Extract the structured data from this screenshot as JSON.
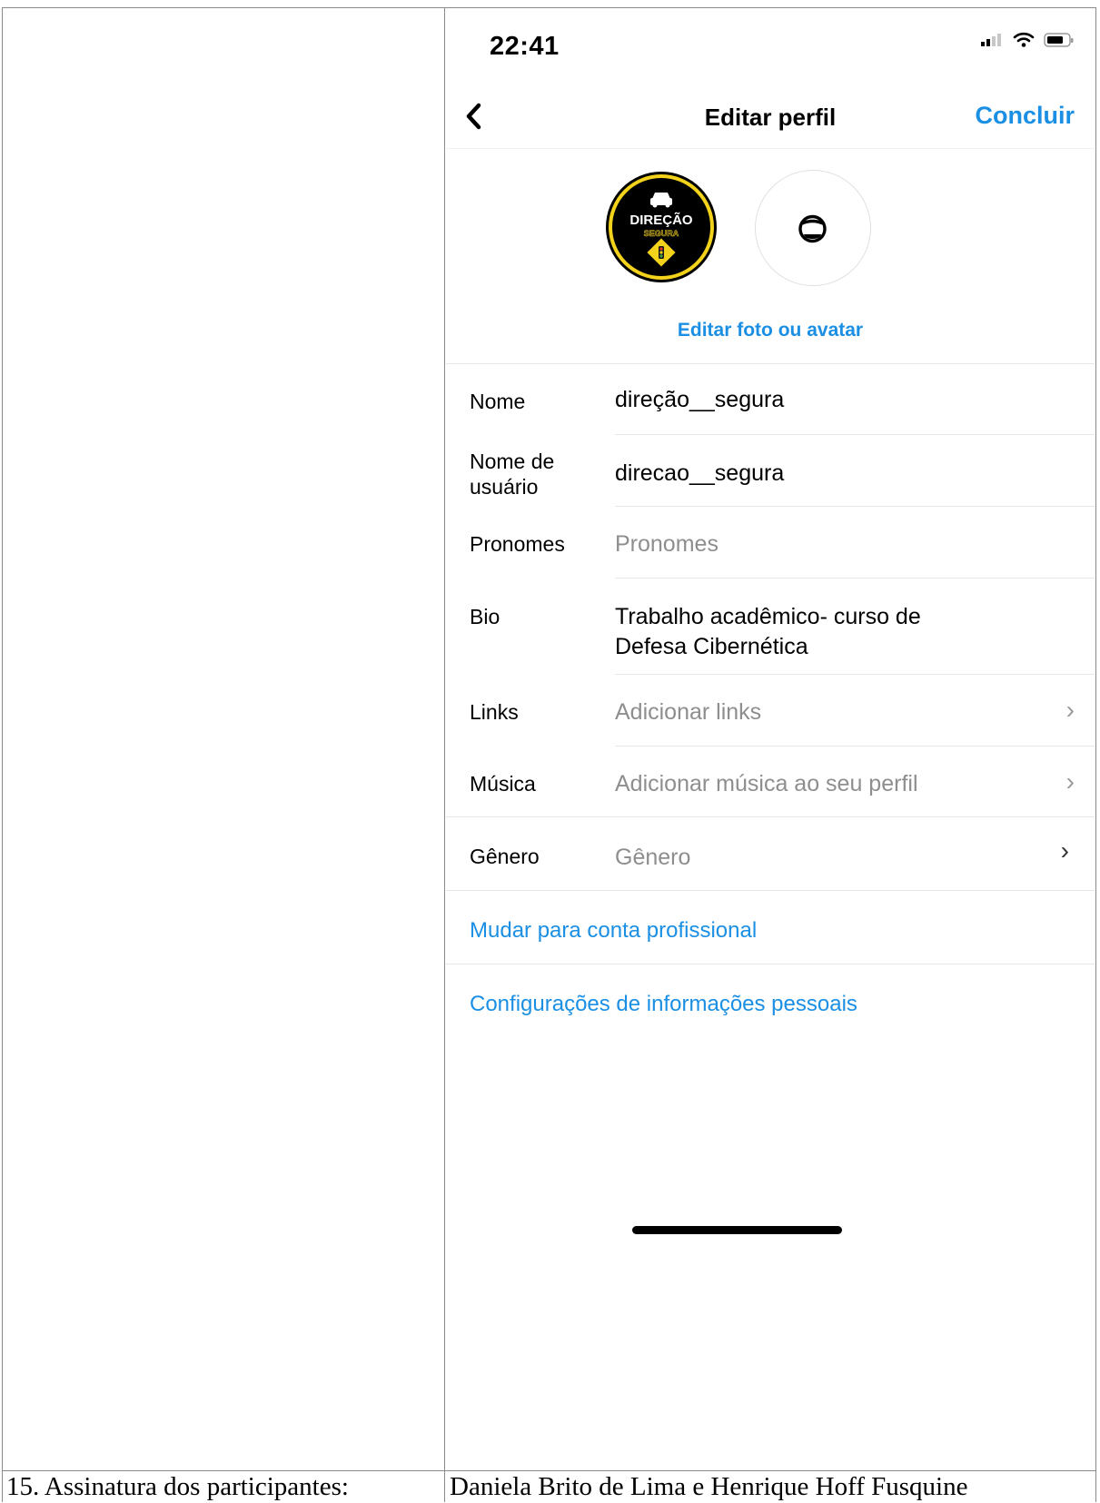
{
  "status_bar": {
    "time": "22:41"
  },
  "nav": {
    "title": "Editar perfil",
    "done_label": "Concluir"
  },
  "avatar": {
    "logo_line1": "DIREÇÃO",
    "logo_line2": "SEGURA",
    "edit_label": "Editar foto ou avatar"
  },
  "fields": {
    "name": {
      "label": "Nome",
      "value": "direção__segura"
    },
    "username": {
      "label_line1": "Nome de",
      "label_line2": "usuário",
      "value": "direcao__segura"
    },
    "pronouns": {
      "label": "Pronomes",
      "placeholder": "Pronomes"
    },
    "bio": {
      "label": "Bio",
      "value_line1": "Trabalho acadêmico- curso de",
      "value_line2": "Defesa Cibernética"
    },
    "links": {
      "label": "Links",
      "placeholder": "Adicionar links"
    },
    "music": {
      "label": "Música",
      "placeholder": "Adicionar música ao seu perfil"
    },
    "gender": {
      "label": "Gênero",
      "placeholder": "Gênero"
    }
  },
  "actions": {
    "professional": "Mudar para conta profissional",
    "personal_info": "Configurações de informações pessoais"
  },
  "document": {
    "footer_left": "15. Assinatura dos participantes:",
    "footer_right": "Daniela Brito de Lima e Henrique Hoff Fusquine"
  },
  "colors": {
    "accent": "#1a8fe3",
    "placeholder": "#8e8e8e",
    "logo_ring": "#f2d21b"
  }
}
